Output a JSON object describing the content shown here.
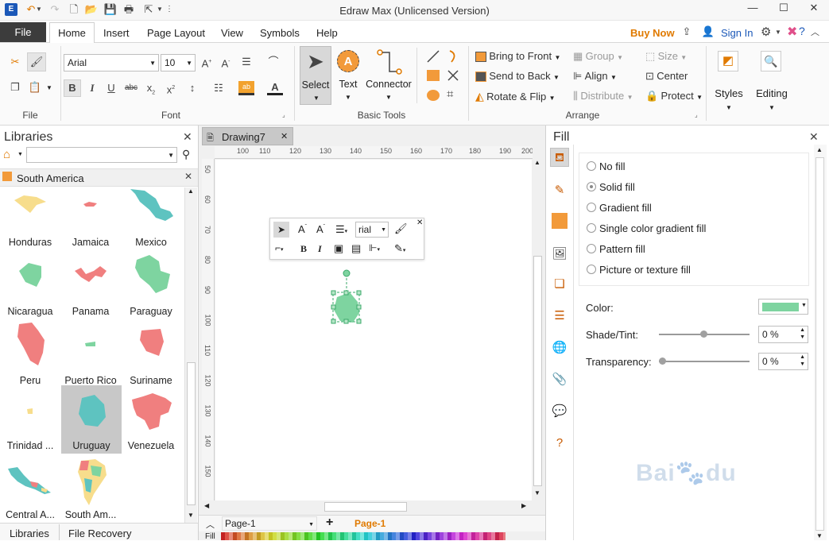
{
  "titlebar": {
    "title": "Edraw Max (Unlicensed Version)"
  },
  "menubar": {
    "file": "File",
    "tabs": [
      "Home",
      "Insert",
      "Page Layout",
      "View",
      "Symbols",
      "Help"
    ],
    "buy_now": "Buy Now",
    "sign_in": "Sign In"
  },
  "ribbon": {
    "groups": {
      "file": "File",
      "font": "Font",
      "basic_tools": "Basic Tools",
      "arrange": "Arrange"
    },
    "font_name": "Arial",
    "font_size": "10",
    "tools": {
      "select": "Select",
      "text": "Text",
      "connector": "Connector"
    },
    "arrange": {
      "bring_to_front": "Bring to Front",
      "send_to_back": "Send to Back",
      "rotate_flip": "Rotate & Flip",
      "group": "Group",
      "align": "Align",
      "distribute": "Distribute",
      "size": "Size",
      "center": "Center",
      "protect": "Protect"
    },
    "styles": "Styles",
    "editing": "Editing"
  },
  "libraries": {
    "title": "Libraries",
    "search_placeholder": "",
    "category": "South America",
    "items": [
      "Honduras",
      "Jamaica",
      "Mexico",
      "Nicaragua",
      "Panama",
      "Paraguay",
      "Peru",
      "Puerto Rico",
      "Suriname",
      "Trinidad ...",
      "Uruguay",
      "Venezuela",
      "Central A...",
      "South Am..."
    ],
    "selected": "Uruguay",
    "bottom_tabs": [
      "Libraries",
      "File Recovery"
    ]
  },
  "document": {
    "tab": "Drawing7",
    "ruler_top": [
      "100",
      "110",
      "120",
      "130",
      "140",
      "150",
      "160",
      "170",
      "180",
      "190",
      "200"
    ],
    "ruler_left": [
      "50",
      "60",
      "70",
      "80",
      "90",
      "100",
      "110",
      "120",
      "130",
      "140",
      "150"
    ],
    "mini_toolbar_font": "rial",
    "page_tab": "Page-1",
    "page_selector": "Page-1",
    "fill_label": "Fill"
  },
  "fill_panel": {
    "title": "Fill",
    "options": [
      "No fill",
      "Solid fill",
      "Gradient fill",
      "Single color gradient fill",
      "Pattern fill",
      "Picture or texture fill"
    ],
    "selected": "Solid fill",
    "color_label": "Color:",
    "color_value": "#7ed4a0",
    "shade_label": "Shade/Tint:",
    "shade_value": "0 %",
    "transparency_label": "Transparency:",
    "transparency_value": "0 %"
  },
  "colors": {
    "accent_orange": "#e07a00",
    "sign_in_blue": "#1b58b8",
    "shape_green": "#7ed4a0",
    "selected_bg": "#c8c8c8"
  }
}
